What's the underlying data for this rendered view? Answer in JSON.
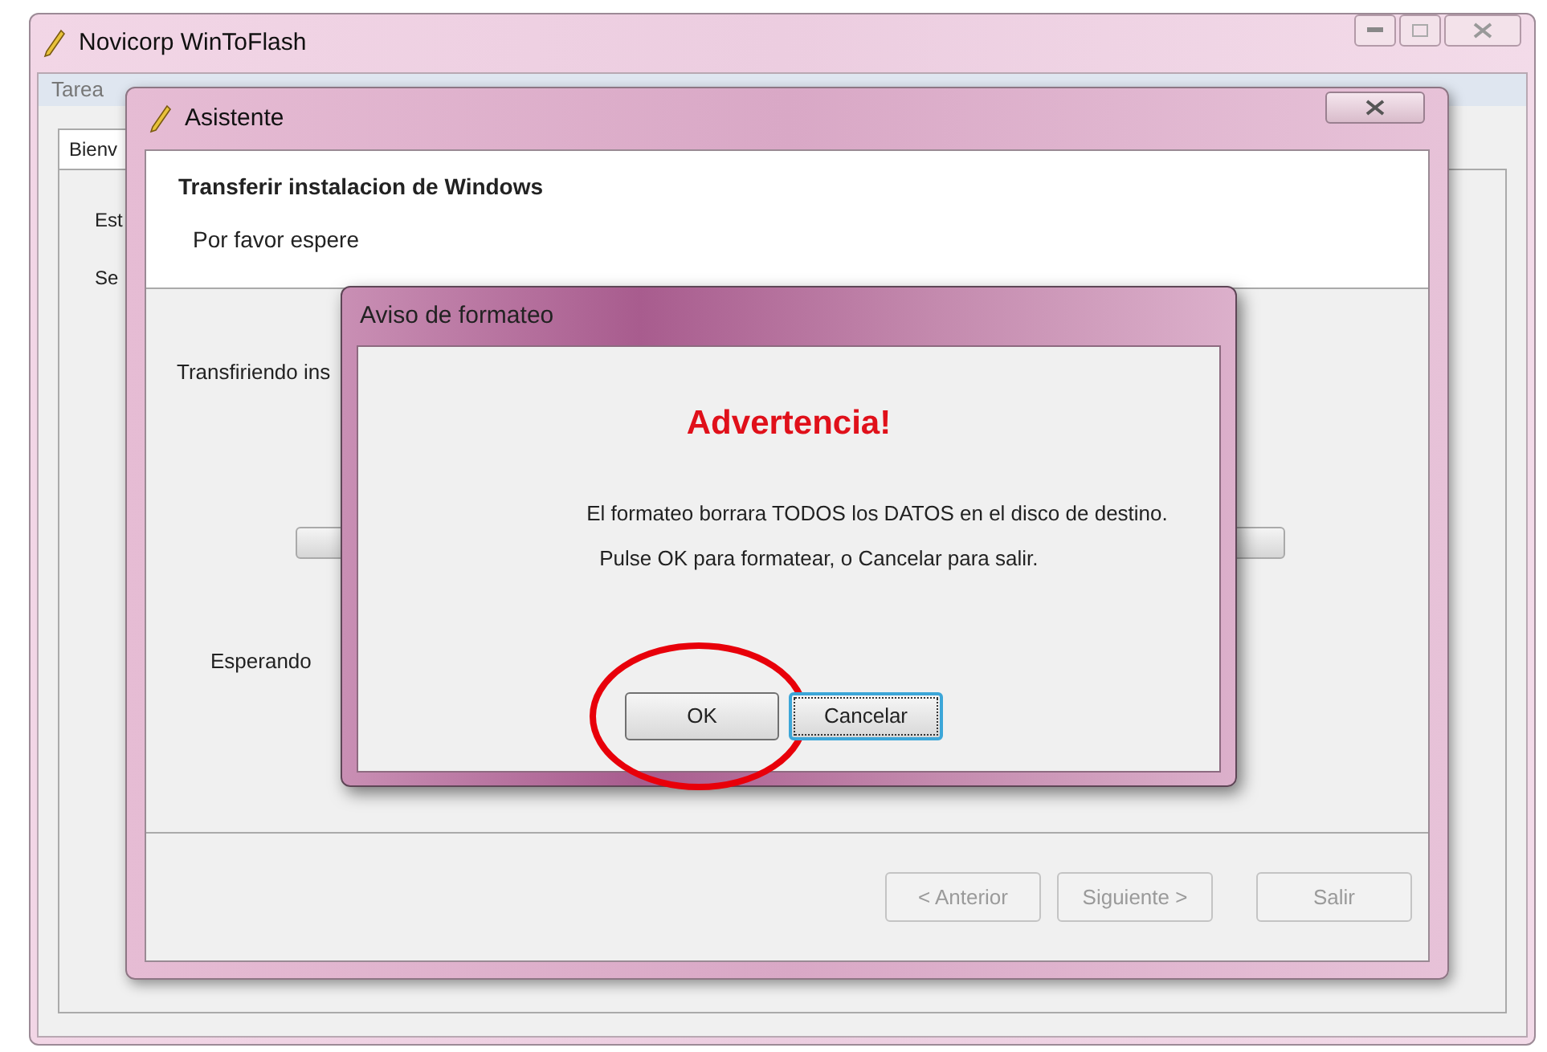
{
  "main_window": {
    "title": "Novicorp WinToFlash",
    "menu": [
      "Tarea"
    ],
    "tab": "Bienv",
    "lines": [
      "Est",
      "Se"
    ]
  },
  "wizard": {
    "title": "Asistente",
    "header_title": "Transferir instalacion de Windows",
    "header_subtitle": "Por favor espere",
    "status": "Transfiriendo ins",
    "progress": {
      "level": 0
    },
    "waiting": "Esperando",
    "buttons": [
      {
        "label": "< Anterior",
        "disabled": true
      },
      {
        "label": "Siguiente >",
        "disabled": true
      },
      {
        "label": "Salir",
        "disabled": true
      }
    ]
  },
  "alert": {
    "title": "Aviso de formateo",
    "heading": "Advertencia!",
    "message": [
      "El formateo borrara TODOS los DATOS en el disco de destino.",
      "Pulse OK para formatear, o Cancelar para salir."
    ],
    "buttons": [
      {
        "label": "OK",
        "focused": false,
        "circled": true
      },
      {
        "label": "Cancelar",
        "focused": true,
        "circled": false
      }
    ]
  }
}
